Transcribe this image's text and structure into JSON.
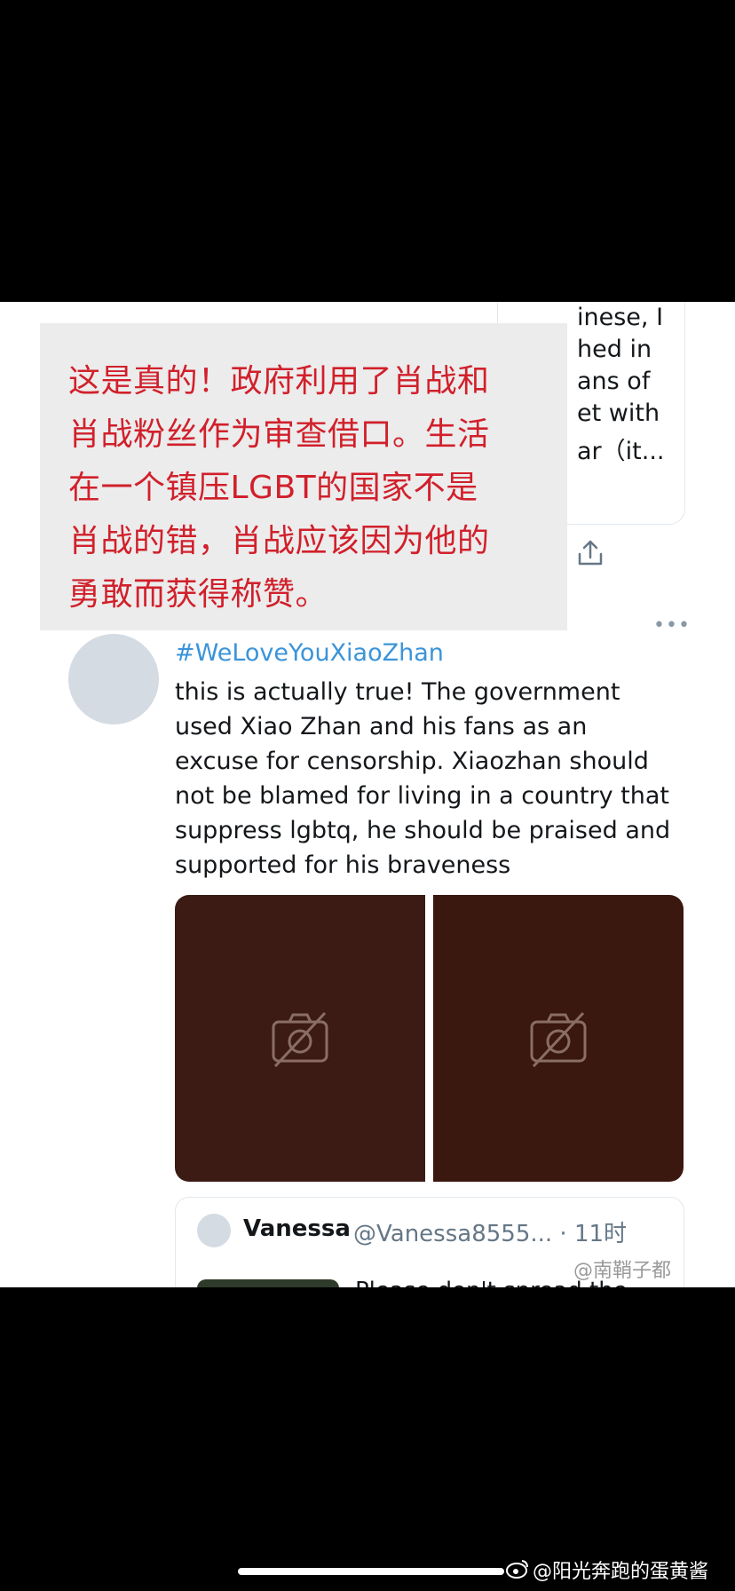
{
  "overlay": {
    "lines": [
      "这是真的！政府利用了肖战和",
      "肖战粉丝作为审查借口。生活",
      "在一个镇压LGBT的国家不是",
      "肖战的错，肖战应该因为他的",
      "勇敢而获得称赞。"
    ],
    "color": "#d1202b"
  },
  "prev_tweet": {
    "lines": [
      "inese, I",
      "hed in",
      "ans of",
      "et with",
      "ar（it..."
    ]
  },
  "tweet": {
    "hashtag": "#WeLoveYouXiaoZhan",
    "lines": [
      "this is actually true! The government",
      "used Xiao Zhan and his fans as an",
      "excuse for censorship. Xiaozhan should",
      "not be blamed for living in a country that",
      "suppress lgbtq, he should be praised and",
      "supported for his braveness"
    ],
    "photos": [
      "camera-off-icon",
      "camera-off-icon"
    ]
  },
  "quote": {
    "name": "Vanessa",
    "handle": "@Vanessa8555... · 11时",
    "text": "Please don't spread the"
  },
  "watermarks": {
    "middle": "@南鞘子都",
    "bottom": "@阳光奔跑的蛋黄酱"
  },
  "icons": [
    "share-icon",
    "more-icon",
    "weibo-icon"
  ]
}
